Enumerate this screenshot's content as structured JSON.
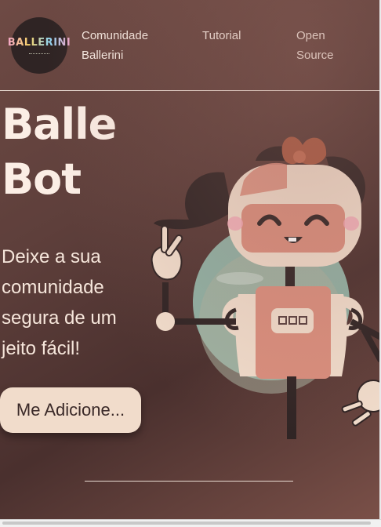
{
  "header": {
    "logo_text": "BALLERINI",
    "nav": [
      {
        "label": "Comunidade Ballerini"
      },
      {
        "label": "Tutorial"
      },
      {
        "label": "Open Source"
      }
    ]
  },
  "hero": {
    "title": "Balle Bot",
    "subtitle": "Deixe a sua comunidade segura de um jeito fácil!",
    "cta_label": "Me Adicione..."
  },
  "colors": {
    "background": "#5e3f3b",
    "text_light": "#fbeee5",
    "button_bg": "#f1dccb",
    "robot_pink": "#d98e7d",
    "robot_cream": "#f0dccb",
    "robot_dark": "#2f2424",
    "window_teal": "#8fb0a3"
  },
  "icons": {
    "logo": "ballerini-logo",
    "illustration": "robot-girl-illustration"
  }
}
